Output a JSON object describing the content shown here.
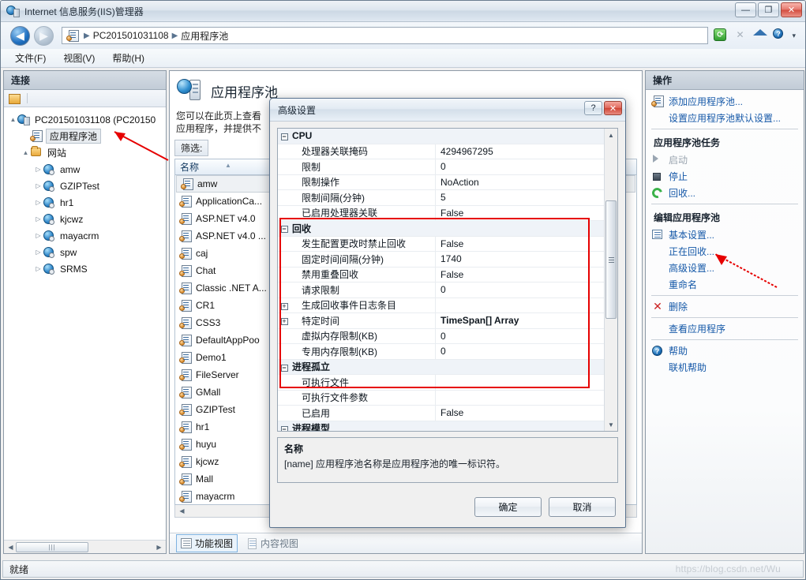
{
  "window": {
    "title": "Internet 信息服务(IIS)管理器",
    "icon": "iis-manager-icon",
    "controls": {
      "minimize": "—",
      "maximize": "❐",
      "close": "✕"
    }
  },
  "addressbar": {
    "back_icon": "back-arrow-icon",
    "forward_icon": "forward-arrow-icon",
    "crumb_icon": "server-node-icon",
    "crumbs": [
      "PC201501031108",
      "应用程序池"
    ],
    "separator": "▶",
    "tools": [
      {
        "name": "refresh-icon",
        "glyph": "⟳"
      },
      {
        "name": "stop-icon",
        "glyph": "✕"
      },
      {
        "name": "home-icon",
        "glyph": "⌂"
      },
      {
        "name": "help-icon",
        "glyph": "?"
      },
      {
        "name": "dropdown-icon",
        "glyph": "▾"
      }
    ]
  },
  "menubar": {
    "items": [
      "文件(F)",
      "视图(V)",
      "帮助(H)"
    ]
  },
  "connections": {
    "header": "连接",
    "toolbar_icon": "new-connection-icon",
    "tree": [
      {
        "label": "PC201501031108 (PC20150",
        "icon": "server-icon",
        "twisty": "▲",
        "depth": 0,
        "selected": false
      },
      {
        "label": "应用程序池",
        "icon": "app-pool-icon",
        "twisty": "",
        "depth": 1,
        "selected": true
      },
      {
        "label": "网站",
        "icon": "sites-folder-icon",
        "twisty": "▲",
        "depth": 1,
        "selected": false
      },
      {
        "label": "amw",
        "icon": "website-icon",
        "twisty": "▷",
        "depth": 2,
        "selected": false
      },
      {
        "label": "GZIPTest",
        "icon": "website-icon",
        "twisty": "▷",
        "depth": 2,
        "selected": false
      },
      {
        "label": "hr1",
        "icon": "website-icon",
        "twisty": "▷",
        "depth": 2,
        "selected": false
      },
      {
        "label": "kjcwz",
        "icon": "website-icon",
        "twisty": "▷",
        "depth": 2,
        "selected": false
      },
      {
        "label": "mayacrm",
        "icon": "website-icon",
        "twisty": "▷",
        "depth": 2,
        "selected": false
      },
      {
        "label": "spw",
        "icon": "website-icon",
        "twisty": "▷",
        "depth": 2,
        "selected": false
      },
      {
        "label": "SRMS",
        "icon": "website-icon",
        "twisty": "▷",
        "depth": 2,
        "selected": false
      }
    ],
    "hscroll": {
      "left_glyph": "◀",
      "right_glyph": "▶",
      "thumb_grip": "|||"
    }
  },
  "main": {
    "title": "应用程序池",
    "title_icon": "app-pools-icon",
    "description_line1": "您可以在此页上查看",
    "description_line2": "应用程序，并提供不",
    "filter_label": "筛选:",
    "column_header": "名称",
    "sort_caret": "▲",
    "pools": [
      "amw",
      "ApplicationCa...",
      "ASP.NET v4.0",
      "ASP.NET v4.0 ...",
      "caj",
      "Chat",
      "Classic .NET A...",
      "CR1",
      "CSS3",
      "DefaultAppPoo",
      "Demo1",
      "FileServer",
      "GMall",
      "GZIPTest",
      "hr1",
      "huyu",
      "kjcwz",
      "Mall",
      "mayacrm"
    ],
    "selected_pool": "amw",
    "hscroll": {
      "left_glyph": "◀"
    },
    "view_tabs": [
      {
        "label": "功能视图",
        "icon": "features-view-icon",
        "active": true
      },
      {
        "label": "内容视图",
        "icon": "content-view-icon",
        "active": false
      }
    ]
  },
  "actions": {
    "header": "操作",
    "items": [
      {
        "label": "添加应用程序池...",
        "icon": "add-app-pool-icon",
        "type": "link",
        "disabled": false
      },
      {
        "label": "设置应用程序池默认设置...",
        "icon": "",
        "type": "link",
        "disabled": false
      },
      {
        "type": "separator"
      },
      {
        "label": "应用程序池任务",
        "type": "group"
      },
      {
        "label": "启动",
        "icon": "start-icon",
        "type": "link",
        "disabled": true
      },
      {
        "label": "停止",
        "icon": "stop-square-icon",
        "type": "link",
        "disabled": false
      },
      {
        "label": "回收...",
        "icon": "recycle-icon",
        "type": "link",
        "disabled": false
      },
      {
        "type": "separator"
      },
      {
        "label": "编辑应用程序池",
        "type": "group"
      },
      {
        "label": "基本设置...",
        "icon": "basic-settings-icon",
        "type": "link",
        "disabled": false
      },
      {
        "label": "正在回收...",
        "icon": "",
        "type": "link",
        "disabled": false
      },
      {
        "label": "高级设置...",
        "icon": "",
        "type": "link",
        "disabled": false
      },
      {
        "label": "重命名",
        "icon": "",
        "type": "link",
        "disabled": false
      },
      {
        "type": "separator"
      },
      {
        "label": "删除",
        "icon": "delete-icon",
        "type": "link",
        "disabled": false
      },
      {
        "type": "separator"
      },
      {
        "label": "查看应用程序",
        "icon": "",
        "type": "link",
        "disabled": false
      },
      {
        "type": "separator"
      },
      {
        "label": "帮助",
        "icon": "help-circle-icon",
        "type": "link",
        "disabled": false
      },
      {
        "label": "联机帮助",
        "icon": "",
        "type": "link",
        "disabled": false
      }
    ]
  },
  "dialog": {
    "title": "高级设置",
    "help_button": "?",
    "close_button": "✕",
    "rows": [
      {
        "kind": "category",
        "expander": "−",
        "name": "CPU",
        "value": ""
      },
      {
        "kind": "prop",
        "expander": "",
        "name": "处理器关联掩码",
        "value": "4294967295"
      },
      {
        "kind": "prop",
        "expander": "",
        "name": "限制",
        "value": "0"
      },
      {
        "kind": "prop",
        "expander": "",
        "name": "限制操作",
        "value": "NoAction"
      },
      {
        "kind": "prop",
        "expander": "",
        "name": "限制间隔(分钟)",
        "value": "5"
      },
      {
        "kind": "prop",
        "expander": "",
        "name": "已启用处理器关联",
        "value": "False"
      },
      {
        "kind": "category",
        "expander": "−",
        "name": "回收",
        "value": ""
      },
      {
        "kind": "prop",
        "expander": "",
        "name": "发生配置更改时禁止回收",
        "value": "False"
      },
      {
        "kind": "prop",
        "expander": "",
        "name": "固定时间间隔(分钟)",
        "value": "1740"
      },
      {
        "kind": "prop",
        "expander": "",
        "name": "禁用重叠回收",
        "value": "False"
      },
      {
        "kind": "prop",
        "expander": "",
        "name": "请求限制",
        "value": "0"
      },
      {
        "kind": "prop",
        "expander": "+",
        "name": "生成回收事件日志条目",
        "value": ""
      },
      {
        "kind": "prop",
        "expander": "+",
        "name": "特定时间",
        "value": "TimeSpan[] Array",
        "bold": true
      },
      {
        "kind": "prop",
        "expander": "",
        "name": "虚拟内存限制(KB)",
        "value": "0"
      },
      {
        "kind": "prop",
        "expander": "",
        "name": "专用内存限制(KB)",
        "value": "0"
      },
      {
        "kind": "category",
        "expander": "−",
        "name": "进程孤立",
        "value": ""
      },
      {
        "kind": "prop",
        "expander": "",
        "name": "可执行文件",
        "value": ""
      },
      {
        "kind": "prop",
        "expander": "",
        "name": "可执行文件参数",
        "value": ""
      },
      {
        "kind": "prop",
        "expander": "",
        "name": "已启用",
        "value": "False"
      },
      {
        "kind": "category",
        "expander": "−",
        "name": "进程模型",
        "value": ""
      }
    ],
    "scrollbar": {
      "up_glyph": "▲",
      "down_glyph": "▼"
    },
    "description": {
      "title": "名称",
      "text": "[name] 应用程序池名称是应用程序池的唯一标识符。"
    },
    "ok_button": "确定",
    "cancel_button": "取消"
  },
  "statusbar": {
    "text": "就绪",
    "watermark": "https://blog.csdn.net/Wu"
  },
  "colors": {
    "accent_link": "#1558a8",
    "highlight_red": "#e60000",
    "panel_header_bg": "#c2ccd7",
    "category_row_bg": "#eff3f8"
  }
}
